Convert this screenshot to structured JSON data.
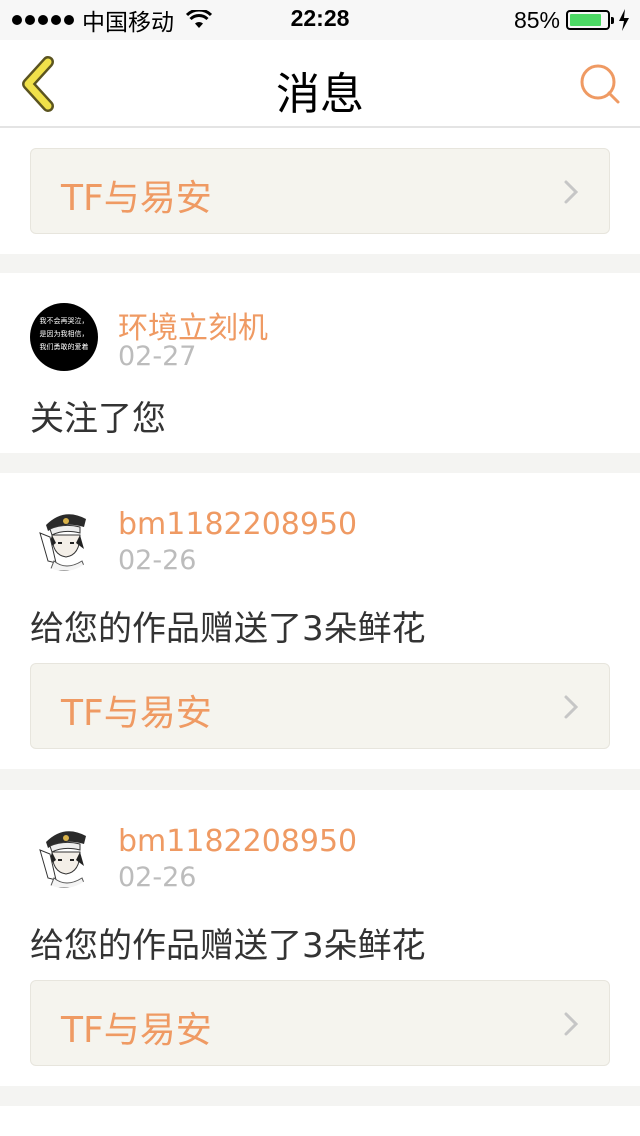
{
  "status_bar": {
    "carrier": "中国移动",
    "time": "22:28",
    "battery": "85%",
    "battery_level": 0.85
  },
  "nav": {
    "title": "消息",
    "back_icon": "chevron-left-icon",
    "search_icon": "search-icon"
  },
  "notifications": [
    {
      "work_title": "TF与易安"
    },
    {
      "username": "环境立刻机",
      "date": "02-27",
      "message": "关注了您",
      "avatar_text": [
        "我不会再哭泣，",
        "是因为我相信，",
        "我们勇敢的爱着"
      ]
    },
    {
      "username": "bm1182208950",
      "date": "02-26",
      "message": "给您的作品赠送了3朵鲜花",
      "work_title": "TF与易安"
    },
    {
      "username": "bm1182208950",
      "date": "02-26",
      "message": "给您的作品赠送了3朵鲜花",
      "work_title": "TF与易安"
    }
  ],
  "colors": {
    "accent": "#ef9a63",
    "nav_back": "#f0e14a",
    "card_bg": "#f5f4ee",
    "battery": "#4cd964"
  }
}
